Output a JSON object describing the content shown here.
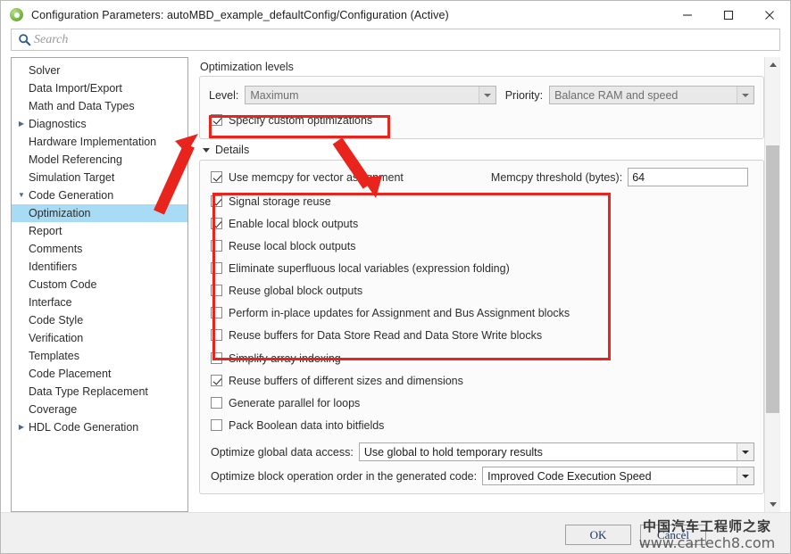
{
  "window": {
    "title": "Configuration Parameters: autoMBD_example_defaultConfig/Configuration (Active)",
    "icon": "simulink-gear-icon",
    "minimize_label": "Minimize",
    "maximize_label": "Maximize",
    "close_label": "Close"
  },
  "search": {
    "placeholder": "Search",
    "value": "",
    "icon": "search-icon"
  },
  "tree": {
    "items": [
      {
        "label": "Solver",
        "level": 0,
        "twisty": "",
        "selected": false
      },
      {
        "label": "Data Import/Export",
        "level": 0,
        "twisty": "",
        "selected": false
      },
      {
        "label": "Math and Data Types",
        "level": 0,
        "twisty": "",
        "selected": false
      },
      {
        "label": "Diagnostics",
        "level": 0,
        "twisty": "▶",
        "selected": false
      },
      {
        "label": "Hardware Implementation",
        "level": 0,
        "twisty": "",
        "selected": false
      },
      {
        "label": "Model Referencing",
        "level": 0,
        "twisty": "",
        "selected": false
      },
      {
        "label": "Simulation Target",
        "level": 0,
        "twisty": "",
        "selected": false
      },
      {
        "label": "Code Generation",
        "level": 0,
        "twisty": "▼",
        "selected": false
      },
      {
        "label": "Optimization",
        "level": 1,
        "twisty": "",
        "selected": true
      },
      {
        "label": "Report",
        "level": 1,
        "twisty": "",
        "selected": false
      },
      {
        "label": "Comments",
        "level": 1,
        "twisty": "",
        "selected": false
      },
      {
        "label": "Identifiers",
        "level": 1,
        "twisty": "",
        "selected": false
      },
      {
        "label": "Custom Code",
        "level": 1,
        "twisty": "",
        "selected": false
      },
      {
        "label": "Interface",
        "level": 1,
        "twisty": "",
        "selected": false
      },
      {
        "label": "Code Style",
        "level": 1,
        "twisty": "",
        "selected": false
      },
      {
        "label": "Verification",
        "level": 1,
        "twisty": "",
        "selected": false
      },
      {
        "label": "Templates",
        "level": 1,
        "twisty": "",
        "selected": false
      },
      {
        "label": "Code Placement",
        "level": 1,
        "twisty": "",
        "selected": false
      },
      {
        "label": "Data Type Replacement",
        "level": 1,
        "twisty": "",
        "selected": false
      },
      {
        "label": "Coverage",
        "level": 0,
        "twisty": "",
        "selected": false
      },
      {
        "label": "HDL Code Generation",
        "level": 0,
        "twisty": "▶",
        "selected": false
      }
    ]
  },
  "main": {
    "group_title": "Optimization levels",
    "level_label": "Level:",
    "level_value": "Maximum",
    "priority_label": "Priority:",
    "priority_value": "Balance RAM and speed",
    "specify_custom": {
      "label": "Specify custom optimizations",
      "checked": true
    },
    "details_label": "Details",
    "memcpy": {
      "label": "Use memcpy for vector assignment",
      "checked": true
    },
    "memcpy_threshold_label": "Memcpy threshold (bytes):",
    "memcpy_threshold_value": "64",
    "boxed_options": [
      {
        "label": "Signal storage reuse",
        "checked": true
      },
      {
        "label": "Enable local block outputs",
        "checked": true
      },
      {
        "label": "Reuse local block outputs",
        "checked": false
      },
      {
        "label": "Eliminate superfluous local variables (expression folding)",
        "checked": false
      },
      {
        "label": "Reuse global block outputs",
        "checked": false
      },
      {
        "label": "Perform in-place updates for Assignment and Bus Assignment blocks",
        "checked": false
      },
      {
        "label": "Reuse buffers for Data Store Read and Data Store Write blocks",
        "checked": false
      }
    ],
    "more_options": [
      {
        "label": "Simplify array indexing",
        "checked": false
      },
      {
        "label": "Reuse buffers of different sizes and dimensions",
        "checked": true
      },
      {
        "label": "Generate parallel for loops",
        "checked": false
      },
      {
        "label": "Pack Boolean data into bitfields",
        "checked": false
      }
    ],
    "global_access_label": "Optimize global data access:",
    "global_access_value": "Use global to hold temporary results",
    "block_order_label": "Optimize block operation order in the generated code:",
    "block_order_value": "Improved Code Execution Speed"
  },
  "scrollbar": {
    "up_icon": "scroll-up-arrow-icon",
    "down_icon": "scroll-down-arrow-icon"
  },
  "footer": {
    "ok_label": "OK",
    "cancel_label": "Cancel"
  },
  "watermark": {
    "chinese": "中国汽车工程师之家",
    "url": "www.cartech8.com"
  },
  "annotations": {
    "highlight_color": "#e8241c",
    "box_specify": {
      "label": "highlight-specify-custom-optimizations"
    },
    "box_options": {
      "label": "highlight-optimization-checkbox-group"
    },
    "arrow": {
      "label": "pointer-arrow-to-specify-custom"
    },
    "arrow2": {
      "label": "pointer-arrow-to-checkbox-group"
    }
  }
}
